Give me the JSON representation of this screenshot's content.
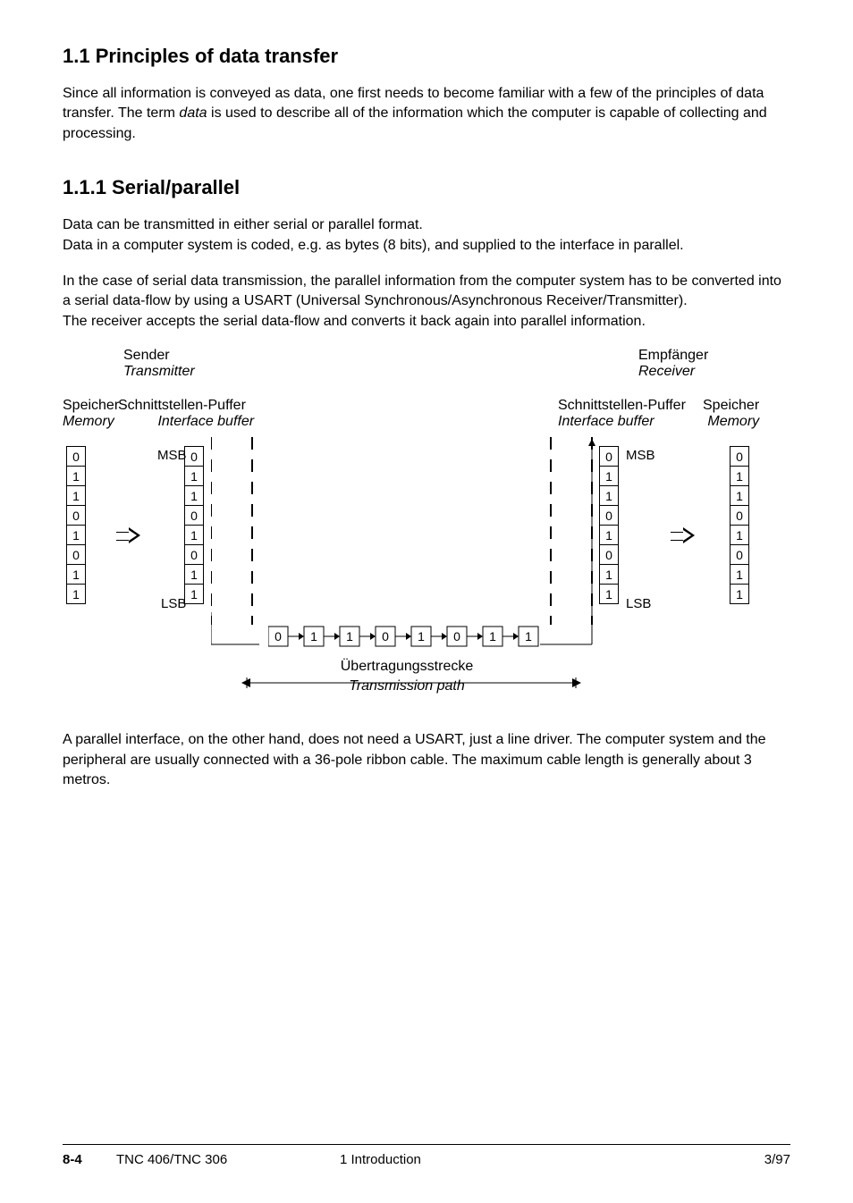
{
  "headings": {
    "h1_1": "1.1  Principles of data transfer",
    "h1_1_1": "1.1.1  Serial/parallel"
  },
  "paras": {
    "p1": "Since all information is conveyed as data, one first needs to become familiar with a few of the principles of data transfer. The term ",
    "p1_em": "data",
    "p1_b": " is used to describe all of the information which the computer is capable of collecting and processing.",
    "p2a": "Data can be transmitted in either serial or parallel format.",
    "p2b": "Data in a computer system is coded, e.g. as bytes (8 bits), and supplied to the interface in parallel.",
    "p3a": "In the case of serial data transmission, the parallel information from the computer system has to be converted into a serial data-flow by using a USART (Universal Synchronous/Asynchronous Receiver/Transmitter).",
    "p3b": "The receiver accepts the serial data-flow and converts it back again into parallel information.",
    "p4": "A parallel interface, on the other hand, does not need a USART, just a line driver. The computer system and the peripheral are usually connected with a 36-pole ribbon cable. The maximum cable length is generally about 3 metros."
  },
  "diagram": {
    "sender_de": "Sender",
    "sender_en": "Transmitter",
    "receiver_de": "Empfänger",
    "receiver_en": "Receiver",
    "mem_de": "Speicher",
    "mem_en": "Memory",
    "buf_de": "Schnittstellen-Puffer",
    "buf_en": "Interface buffer",
    "msb": "MSB",
    "lsb": "LSB",
    "trans_de": "Übertragungsstrecke",
    "trans_en": "Transmission path",
    "bits": [
      "0",
      "1",
      "1",
      "0",
      "1",
      "0",
      "1",
      "1"
    ],
    "serial": [
      "0",
      "1",
      "1",
      "0",
      "1",
      "0",
      "1",
      "1"
    ]
  },
  "footer": {
    "page": "8-4",
    "doc": "TNC 406/TNC 306",
    "section": "1  Introduction",
    "date": "3/97"
  }
}
